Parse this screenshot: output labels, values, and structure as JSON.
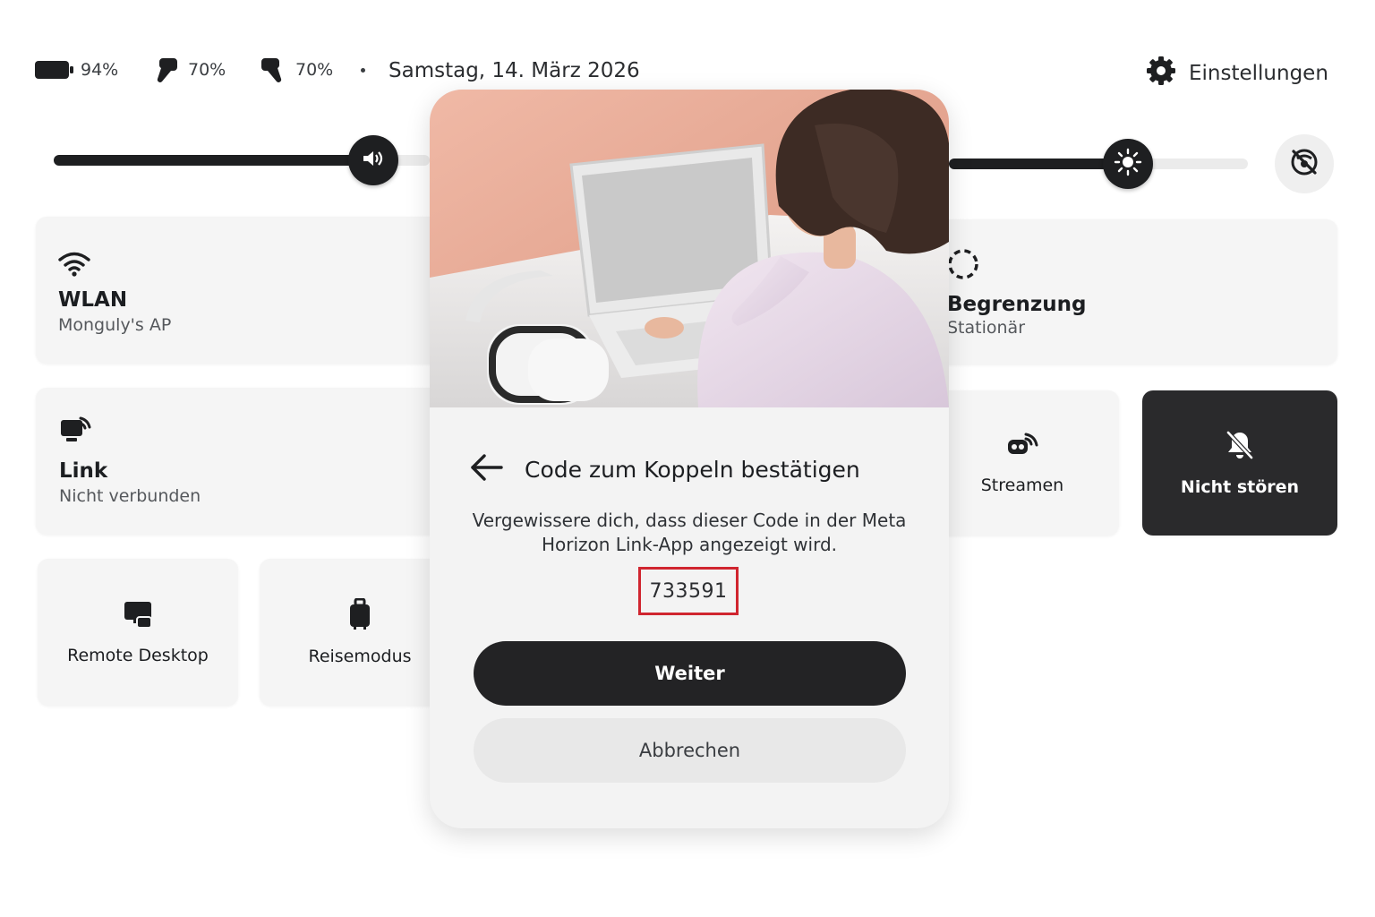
{
  "status_bar": {
    "headset_battery": "94%",
    "left_controller_battery": "70%",
    "right_controller_battery": "70%",
    "date": "Samstag, 14. März 2026",
    "settings_label": "Einstellungen"
  },
  "sliders": {
    "volume_level": 0.85,
    "brightness_level": 0.6
  },
  "tiles": {
    "wifi": {
      "title": "WLAN",
      "subtitle": "Monguly's AP"
    },
    "link": {
      "title": "Link",
      "subtitle": "Nicht verbunden"
    },
    "boundary": {
      "title": "Begrenzung",
      "subtitle": "Stationär"
    },
    "remote_desktop": {
      "label": "Remote Desktop"
    },
    "travel_mode": {
      "label": "Reisemodus"
    },
    "stream": {
      "label": "Streamen"
    },
    "do_not_disturb": {
      "label": "Nicht stören"
    }
  },
  "dialog": {
    "title": "Code zum Koppeln bestätigen",
    "description": "Vergewissere dich, dass dieser Code in der Meta Horizon Link-App angezeigt wird.",
    "code": "733591",
    "continue_label": "Weiter",
    "cancel_label": "Abbrechen"
  },
  "colors": {
    "dark": "#232325",
    "highlight_border": "#d0252f",
    "tile_bg": "#f5f5f5"
  }
}
